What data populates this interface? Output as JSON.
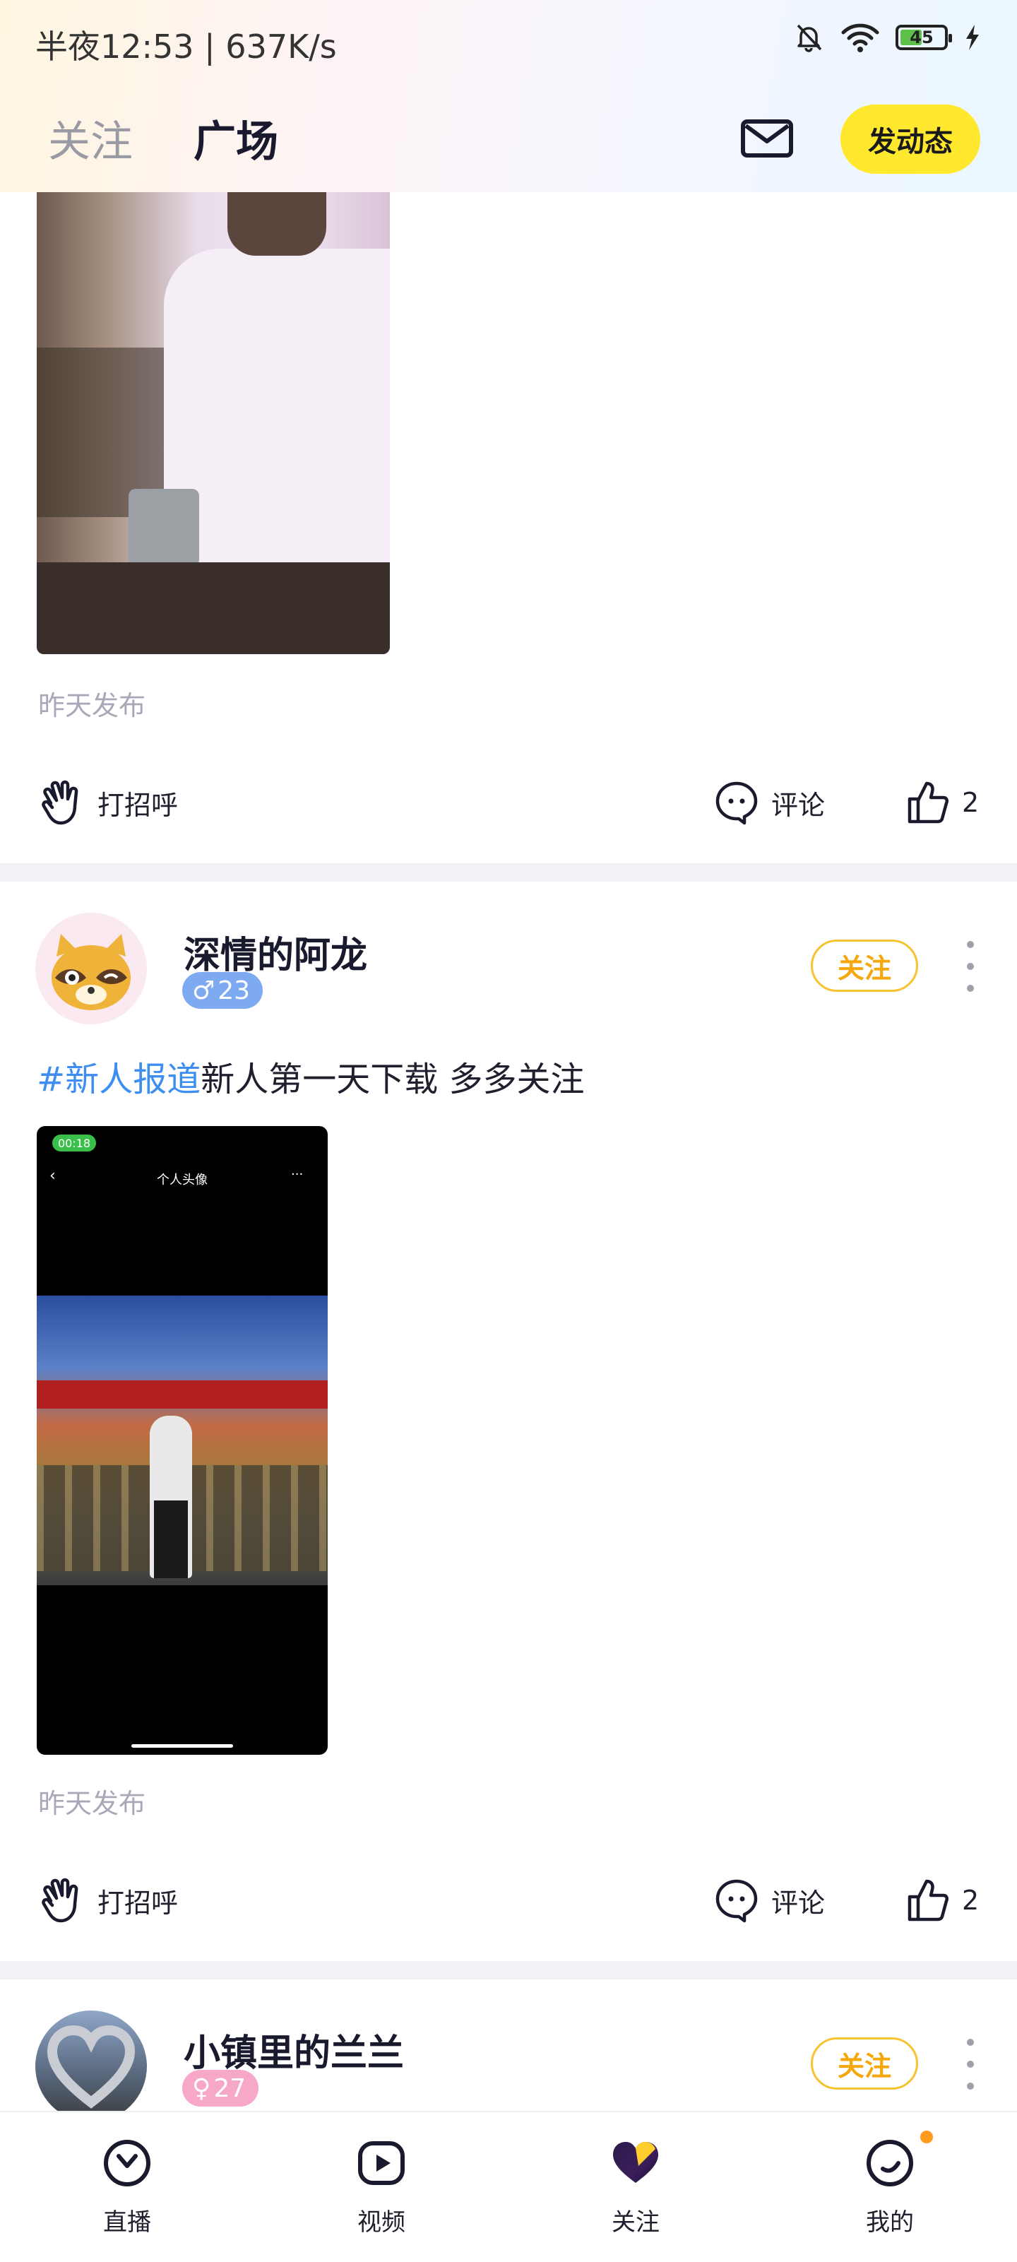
{
  "status_bar": {
    "time": "半夜12:53 | 637K/s",
    "battery": "45"
  },
  "header": {
    "tabs": [
      {
        "label": "关注",
        "active": false
      },
      {
        "label": "广场",
        "active": true
      }
    ],
    "post_button": "发动态",
    "mail_icon": "mail-icon"
  },
  "posts": [
    {
      "time": "昨天发布",
      "greet": "打招呼",
      "comment": "评论",
      "likes": "2"
    },
    {
      "username": "深情的阿龙",
      "gender": "♂",
      "age": "23",
      "follow": "关注",
      "tag": "#新人报道",
      "text": "新人第一天下载 多多关注",
      "shot": {
        "pill": "00:18",
        "title": "个人头像",
        "menu": "···"
      },
      "time": "昨天发布",
      "greet": "打招呼",
      "comment": "评论",
      "likes": "2"
    },
    {
      "username": "小镇里的兰兰",
      "gender": "♀",
      "age": "27",
      "follow": "关注"
    }
  ],
  "bottom_nav": [
    {
      "label": "直播",
      "icon": "live-icon"
    },
    {
      "label": "视频",
      "icon": "video-icon"
    },
    {
      "label": "关注",
      "icon": "heart-icon"
    },
    {
      "label": "我的",
      "icon": "profile-icon"
    }
  ],
  "colors": {
    "accent_yellow": "#ffe82e",
    "follow_orange": "#f5a70b",
    "tag_blue": "#3d8ef0",
    "male_badge": "#7eaaf2",
    "female_badge": "#f7a7c8"
  }
}
